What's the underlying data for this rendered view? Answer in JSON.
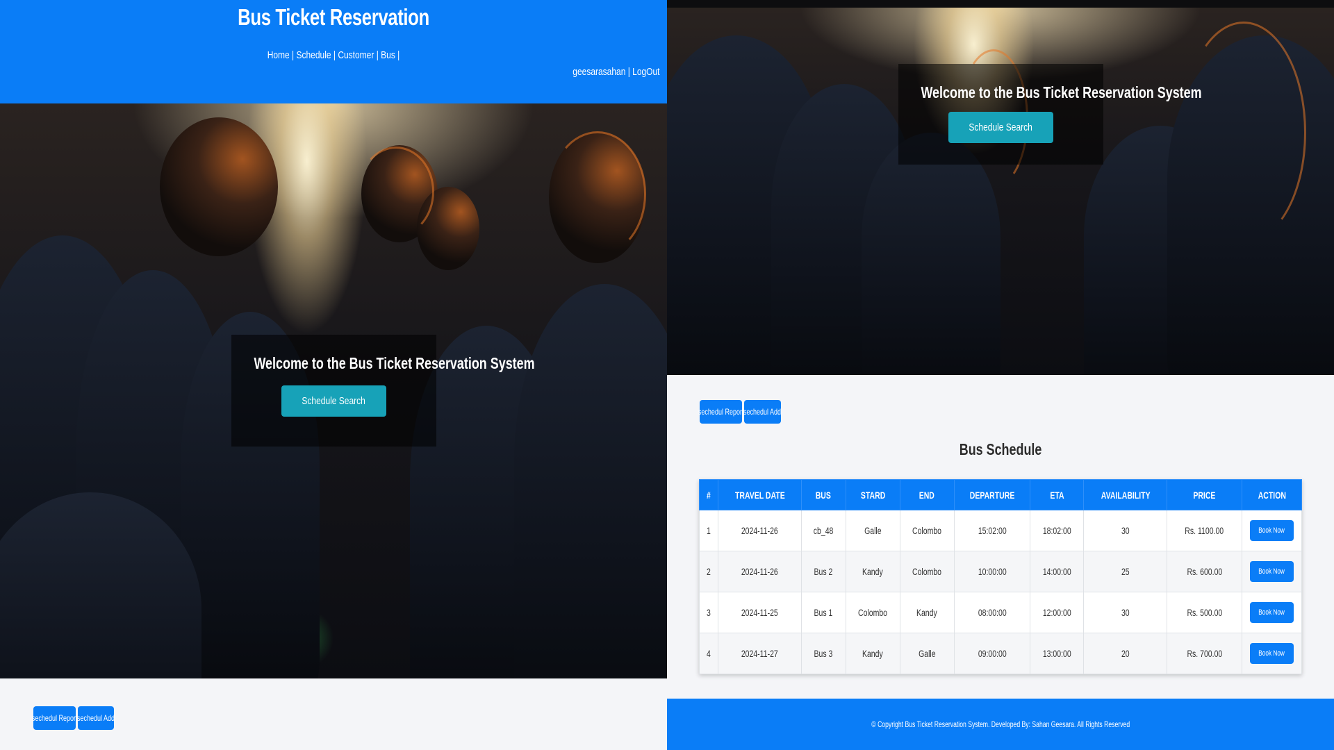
{
  "header": {
    "title": "Bus Ticket Reservation",
    "nav": [
      {
        "label": "Home"
      },
      {
        "label": "Schedule"
      },
      {
        "label": "Customer"
      },
      {
        "label": "Bus"
      }
    ],
    "username": "geesarasahan",
    "logout_label": "LogOut"
  },
  "hero": {
    "welcome_text": "Welcome to the Bus Ticket Reservation System",
    "search_button": "Schedule Search"
  },
  "toolbar": {
    "report_button": "sechedul Report",
    "add_button": "sechedul Add"
  },
  "schedule": {
    "title": "Bus Schedule",
    "columns": [
      "#",
      "TRAVEL DATE",
      "BUS",
      "STARD",
      "END",
      "DEPARTURE",
      "ETA",
      "AVAILABILITY",
      "PRICE",
      "ACTION"
    ],
    "rows": [
      {
        "num": "1",
        "date": "2024-11-26",
        "bus": "cb_48",
        "start": "Galle",
        "end": "Colombo",
        "departure": "15:02:00",
        "eta": "18:02:00",
        "availability": "30",
        "price": "Rs. 1100.00",
        "action": "Book Now"
      },
      {
        "num": "2",
        "date": "2024-11-26",
        "bus": "Bus 2",
        "start": "Kandy",
        "end": "Colombo",
        "departure": "10:00:00",
        "eta": "14:00:00",
        "availability": "25",
        "price": "Rs. 600.00",
        "action": "Book Now"
      },
      {
        "num": "3",
        "date": "2024-11-25",
        "bus": "Bus 1",
        "start": "Colombo",
        "end": "Kandy",
        "departure": "08:00:00",
        "eta": "12:00:00",
        "availability": "30",
        "price": "Rs. 500.00",
        "action": "Book Now"
      },
      {
        "num": "4",
        "date": "2024-11-27",
        "bus": "Bus 3",
        "start": "Kandy",
        "end": "Galle",
        "departure": "09:00:00",
        "eta": "13:00:00",
        "availability": "20",
        "price": "Rs. 700.00",
        "action": "Book Now"
      }
    ]
  },
  "footer": {
    "text": "© Copyright Bus Ticket Reservation System. Developed By: Sahan Geesara. All Rights Reserved"
  },
  "colors": {
    "primary": "#0a7df7",
    "accent": "#17a2b8",
    "background": "#f4f5f8"
  }
}
